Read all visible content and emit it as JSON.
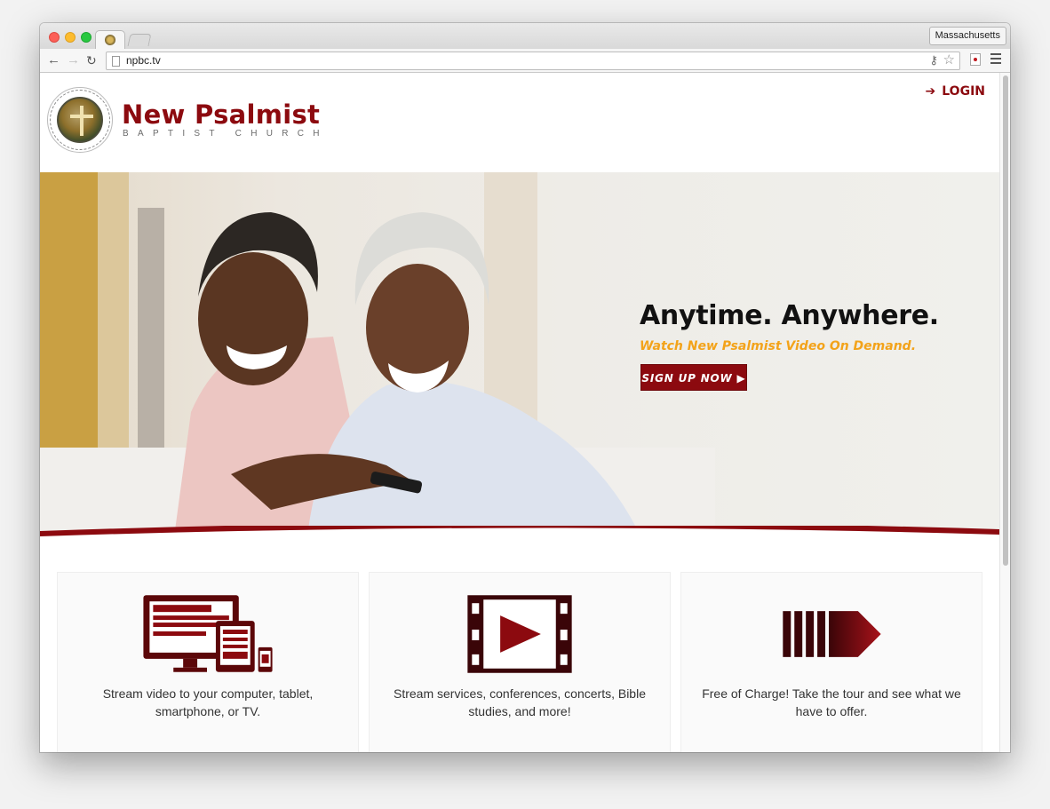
{
  "browser": {
    "tab_title": "",
    "profile_label": "Massachusetts",
    "url": "npbc.tv",
    "icons": [
      "back-arrow-icon",
      "forward-arrow-icon",
      "reload-icon",
      "page-icon",
      "key-icon",
      "star-icon",
      "extension-icon",
      "menu-icon"
    ]
  },
  "site": {
    "brand_name": "New Psalmist",
    "brand_subtitle": "BAPTIST CHURCH",
    "login_label": "LOGIN",
    "brand_color": "#8c0a0f",
    "accent_color": "#f3a31a"
  },
  "hero": {
    "title": "Anytime. Anywhere.",
    "subtitle": "Watch New Psalmist Video On Demand.",
    "cta_label": "SIGN UP NOW ▶"
  },
  "features": [
    {
      "icon": "devices-icon",
      "text": "Stream video to your computer, tablet, smartphone, or TV."
    },
    {
      "icon": "film-play-icon",
      "text": "Stream services, conferences, concerts, Bible studies, and more!"
    },
    {
      "icon": "arrow-bars-icon",
      "text": "Free of Charge! Take the tour and see what we have to offer."
    }
  ]
}
